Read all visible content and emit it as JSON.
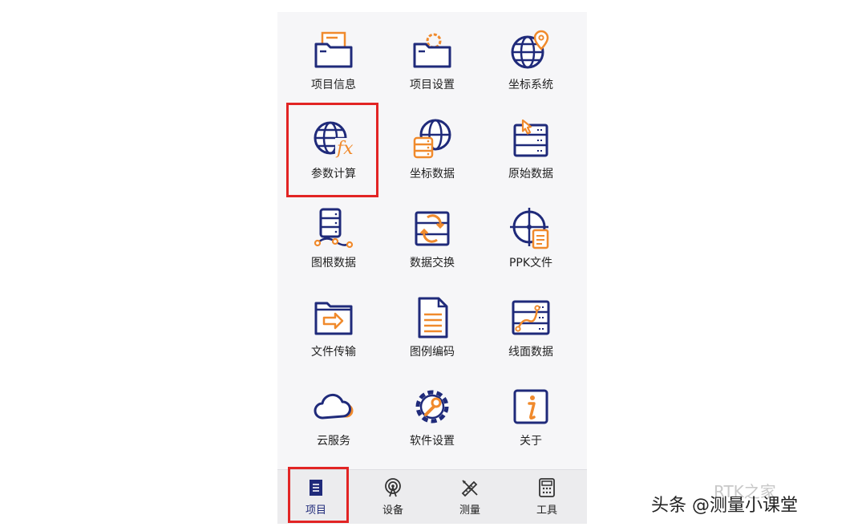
{
  "colors": {
    "navy": "#1f2a7a",
    "orange": "#f08a2c",
    "highlight": "#e22424"
  },
  "grid": {
    "items": [
      {
        "label": "项目信息",
        "icon": "folder-doc-icon"
      },
      {
        "label": "项目设置",
        "icon": "folder-gear-icon"
      },
      {
        "label": "坐标系统",
        "icon": "globe-pin-icon"
      },
      {
        "label": "参数计算",
        "icon": "globe-fx-icon"
      },
      {
        "label": "坐标数据",
        "icon": "globe-database-icon"
      },
      {
        "label": "原始数据",
        "icon": "table-cursor-icon"
      },
      {
        "label": "图根数据",
        "icon": "database-route-icon"
      },
      {
        "label": "数据交换",
        "icon": "table-swap-icon"
      },
      {
        "label": "PPK文件",
        "icon": "crosshair-doc-icon"
      },
      {
        "label": "文件传输",
        "icon": "folder-arrow-icon"
      },
      {
        "label": "图例编码",
        "icon": "document-lines-icon"
      },
      {
        "label": "线面数据",
        "icon": "table-line-icon"
      },
      {
        "label": "云服务",
        "icon": "cloud-icon"
      },
      {
        "label": "软件设置",
        "icon": "gear-wrench-icon"
      },
      {
        "label": "关于",
        "icon": "info-icon"
      }
    ]
  },
  "tabbar": {
    "tabs": [
      {
        "label": "项目",
        "icon": "project-icon",
        "active": true
      },
      {
        "label": "设备",
        "icon": "antenna-icon",
        "active": false
      },
      {
        "label": "测量",
        "icon": "ruler-pencil-icon",
        "active": false
      },
      {
        "label": "工具",
        "icon": "calculator-icon",
        "active": false
      }
    ]
  },
  "watermark": {
    "text": "头条 @测量小课堂",
    "ghost": "RTK之家"
  }
}
